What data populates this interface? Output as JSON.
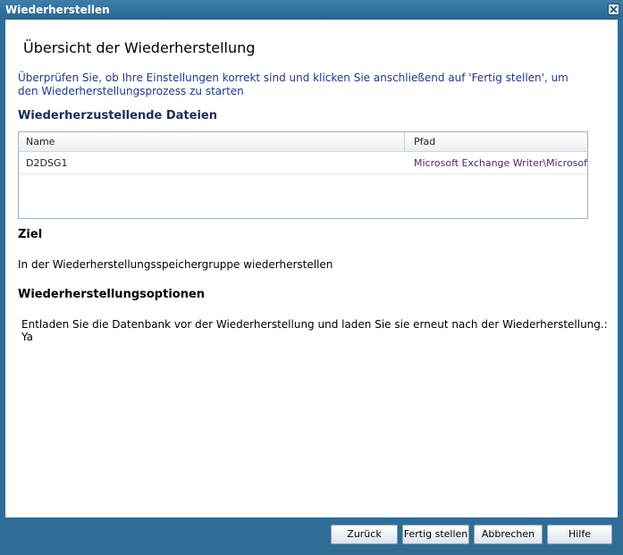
{
  "window": {
    "title": "Wiederherstellen"
  },
  "page": {
    "heading": "Übersicht der Wiederherstellung",
    "intro": "Überprüfen Sie, ob Ihre Einstellungen korrekt sind und klicken Sie anschließend auf 'Fertig stellen', um den Wiederherstellungsprozess zu starten"
  },
  "files_section": {
    "title": "Wiederherzustellende Dateien",
    "columns": [
      "Name",
      "Pfad"
    ],
    "rows": [
      {
        "name": "D2DSG1",
        "path": "Microsoft Exchange Writer\\Microsoft"
      }
    ]
  },
  "target_section": {
    "title": "Ziel",
    "text": "In der Wiederherstellungsspeichergruppe wiederherstellen"
  },
  "options_section": {
    "title": "Wiederherstellungsoptionen",
    "text": "Entladen Sie die Datenbank vor der Wiederherstellung und laden Sie sie erneut nach der Wiederherstellung.: Ya"
  },
  "footer": {
    "back_label": "Zurück",
    "finish_label": "Fertig stellen",
    "cancel_label": "Abbrechen",
    "help_label": "Hilfe"
  },
  "icons": {
    "close": "close-icon"
  }
}
